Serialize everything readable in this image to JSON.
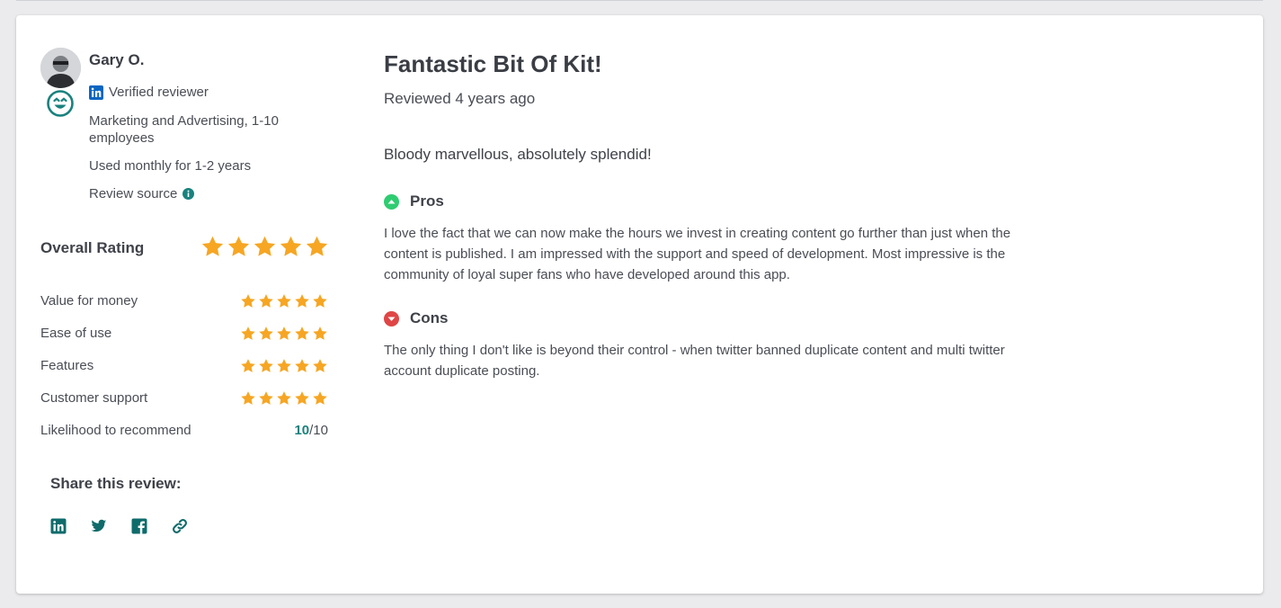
{
  "reviewer": {
    "name": "Gary O.",
    "verified_label": "Verified reviewer",
    "company": "Marketing and Advertising, 1-10 employees",
    "usage": "Used monthly for 1-2 years",
    "source_label": "Review source"
  },
  "ratings": {
    "overall_label": "Overall Rating",
    "overall_stars": 5,
    "rows": [
      {
        "label": "Value for money",
        "stars": 5
      },
      {
        "label": "Ease of use",
        "stars": 5
      },
      {
        "label": "Features",
        "stars": 5
      },
      {
        "label": "Customer support",
        "stars": 5
      }
    ],
    "recommend_label": "Likelihood to recommend",
    "recommend_score": "10",
    "recommend_max": "/10"
  },
  "share": {
    "label": "Share this review:",
    "icons": [
      "linkedin-icon",
      "twitter-icon",
      "facebook-icon",
      "link-icon"
    ]
  },
  "review": {
    "title": "Fantastic Bit Of Kit!",
    "date": "Reviewed 4 years ago",
    "summary": "Bloody marvellous, absolutely splendid!",
    "pros_label": "Pros",
    "pros_text": "I love the fact that we can now make the hours we invest in creating content go further than just when the content is published. I am impressed with the support and speed of development. Most impressive is the community of loyal super fans who have developed around this app.",
    "cons_label": "Cons",
    "cons_text": "The only thing I don't like is beyond their control - when twitter banned duplicate content and multi twitter account duplicate posting."
  },
  "colors": {
    "star": "#f6a623",
    "accent_teal": "#19827e",
    "pros_green": "#2ecc71",
    "cons_red": "#e04545",
    "linkedin_blue": "#0a66c2"
  }
}
